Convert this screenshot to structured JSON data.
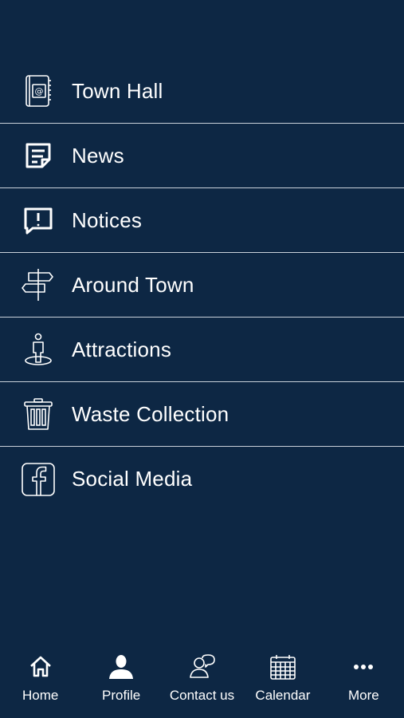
{
  "menu": {
    "items": [
      {
        "label": "Town Hall",
        "icon": "directory-book-icon"
      },
      {
        "label": "News",
        "icon": "news-document-icon"
      },
      {
        "label": "Notices",
        "icon": "notice-alert-icon"
      },
      {
        "label": "Around Town",
        "icon": "signpost-icon"
      },
      {
        "label": "Attractions",
        "icon": "attraction-person-icon"
      },
      {
        "label": "Waste Collection",
        "icon": "trash-bin-icon"
      },
      {
        "label": "Social Media",
        "icon": "facebook-icon"
      }
    ]
  },
  "tabbar": {
    "tabs": [
      {
        "label": "Home",
        "icon": "home-icon"
      },
      {
        "label": "Profile",
        "icon": "profile-icon"
      },
      {
        "label": "Contact us",
        "icon": "contact-icon"
      },
      {
        "label": "Calendar",
        "icon": "calendar-icon"
      },
      {
        "label": "More",
        "icon": "more-icon"
      }
    ]
  },
  "colors": {
    "background": "#0d2744",
    "text": "#ffffff",
    "divider": "#c9d1da"
  }
}
